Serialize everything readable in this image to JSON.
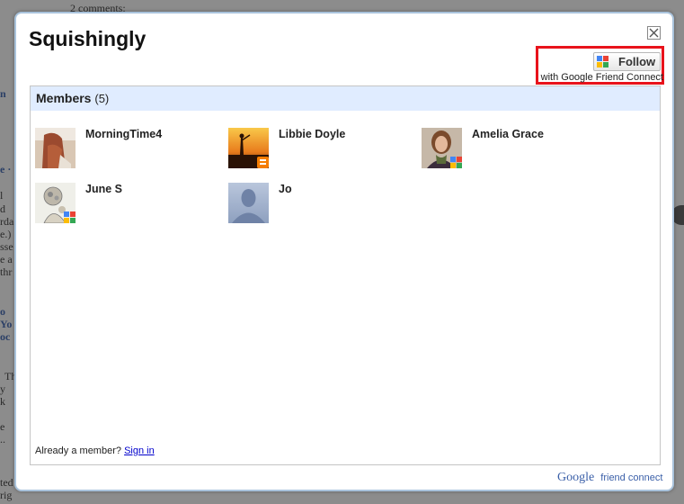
{
  "background": {
    "fragments": [
      "2 comments:",
      "n",
      "e ·",
      "l",
      "d",
      "rda",
      "e.)",
      "sse",
      "e a",
      "thr",
      "o",
      "Yo",
      "oc",
      "Th",
      "y",
      "k",
      "e",
      "..",
      "ted",
      "rig"
    ]
  },
  "dialog": {
    "title": "Squishingly",
    "follow": {
      "button_label": "Follow",
      "subtext": "with Google Friend Connect"
    },
    "members": {
      "label": "Members",
      "count": "(5)",
      "list": [
        {
          "name": "MorningTime4",
          "avatar": "hair-photo",
          "badge": "none"
        },
        {
          "name": "Libbie Doyle",
          "avatar": "sunset-silhouette",
          "badge": "blogger"
        },
        {
          "name": "Amelia Grace",
          "avatar": "woman-portrait",
          "badge": "google"
        },
        {
          "name": "June S",
          "avatar": "floral-drawing",
          "badge": "google"
        },
        {
          "name": "Jo",
          "avatar": "default-silhouette",
          "badge": "none"
        }
      ]
    },
    "footer": {
      "already_text": "Already a member?",
      "sign_in": "Sign in"
    },
    "brand": {
      "google": "Google",
      "friend_connect": "friend connect"
    }
  },
  "colors": {
    "header_bg": "#e0ecff",
    "highlight": "#e8131b",
    "link": "#0000cc",
    "dialog_border": "#a9c3dc"
  }
}
